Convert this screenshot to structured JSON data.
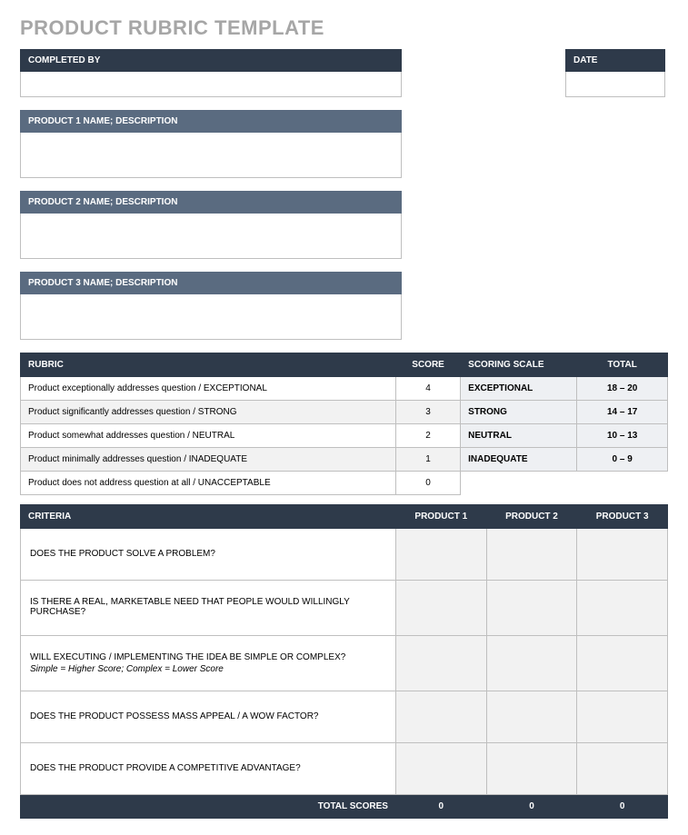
{
  "title": "PRODUCT RUBRIC TEMPLATE",
  "header": {
    "completed_by_label": "COMPLETED BY",
    "date_label": "DATE",
    "completed_by_value": "",
    "date_value": ""
  },
  "products": [
    {
      "label": "PRODUCT 1 NAME; DESCRIPTION",
      "value": ""
    },
    {
      "label": "PRODUCT 2 NAME; DESCRIPTION",
      "value": ""
    },
    {
      "label": "PRODUCT 3 NAME; DESCRIPTION",
      "value": ""
    }
  ],
  "rubric": {
    "headers": {
      "rubric": "RUBRIC",
      "score": "SCORE",
      "scale": "SCORING SCALE",
      "total": "TOTAL"
    },
    "rows": [
      {
        "desc": "Product exceptionally addresses question / EXCEPTIONAL",
        "score": "4",
        "scale": "EXCEPTIONAL",
        "total": "18 – 20"
      },
      {
        "desc": "Product significantly addresses question / STRONG",
        "score": "3",
        "scale": "STRONG",
        "total": "14 – 17"
      },
      {
        "desc": "Product somewhat addresses question / NEUTRAL",
        "score": "2",
        "scale": "NEUTRAL",
        "total": "10 – 13"
      },
      {
        "desc": "Product minimally addresses question / INADEQUATE",
        "score": "1",
        "scale": "INADEQUATE",
        "total": "0 – 9"
      },
      {
        "desc": "Product does not address question at all / UNACCEPTABLE",
        "score": "0",
        "scale": "",
        "total": ""
      }
    ]
  },
  "criteria": {
    "headers": {
      "criteria": "CRITERIA",
      "p1": "PRODUCT 1",
      "p2": "PRODUCT 2",
      "p3": "PRODUCT 3"
    },
    "rows": [
      {
        "text": "DOES THE PRODUCT SOLVE A PROBLEM?",
        "sub": ""
      },
      {
        "text": "IS THERE A REAL, MARKETABLE NEED THAT PEOPLE WOULD WILLINGLY PURCHASE?",
        "sub": ""
      },
      {
        "text": "WILL EXECUTING / IMPLEMENTING THE IDEA BE SIMPLE OR COMPLEX?",
        "sub": "Simple = Higher Score; Complex = Lower Score"
      },
      {
        "text": "DOES THE PRODUCT POSSESS MASS APPEAL / A WOW FACTOR?",
        "sub": ""
      },
      {
        "text": "DOES THE PRODUCT PROVIDE A COMPETITIVE ADVANTAGE?",
        "sub": ""
      }
    ],
    "footer": {
      "label": "TOTAL SCORES",
      "p1": "0",
      "p2": "0",
      "p3": "0"
    }
  }
}
